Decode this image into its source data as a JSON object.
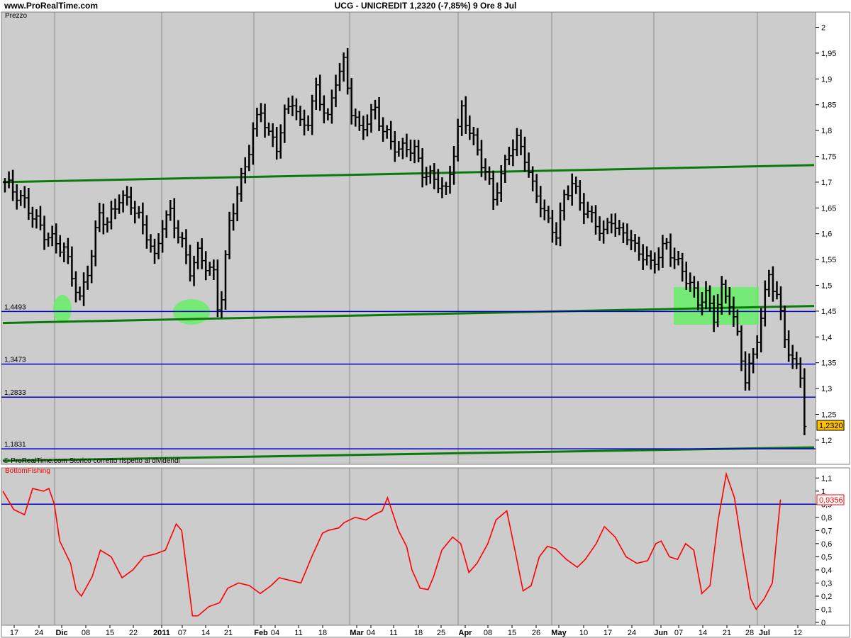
{
  "header": {
    "site": "www.ProRealTime.com",
    "title": "UCG - UNICREDIT    1,2320 (-7,85%)   9 Ore  8 Jul"
  },
  "price_panel": {
    "label": "Prezzo",
    "footer": "© ProRealTime.com   Storico corretto rispetto ai dividendi",
    "last_value_label": "1,2320",
    "support_labels": [
      "1,4493",
      "1,3473",
      "1,2833",
      "1,1831"
    ],
    "y_ticks": [
      "2",
      "1,95",
      "1,9",
      "1,85",
      "1,8",
      "1,75",
      "1,7",
      "1,65",
      "1,6",
      "1,55",
      "1,5",
      "1,45",
      "1,4",
      "1,35",
      "1,3",
      "1,25",
      "1,2"
    ]
  },
  "indicator_panel": {
    "label": "BottomFishing",
    "last_value_label": "0,9356",
    "y_ticks": [
      "1,1",
      "1",
      "0,9",
      "0,8",
      "0,7",
      "0,6",
      "0,5",
      "0,4",
      "0,3",
      "0,2",
      "0,1",
      "0"
    ]
  },
  "x_ticks": [
    "17",
    "24",
    "Dic",
    "08",
    "15",
    "22",
    "2011",
    "07",
    "14",
    "21",
    "Feb",
    "04",
    "11",
    "18",
    "Mar",
    "04",
    "11",
    "18",
    "25",
    "Apr",
    "08",
    "15",
    "26",
    "May",
    "10",
    "17",
    "24",
    "Jun",
    "07",
    "14",
    "21",
    "28",
    "Jul",
    "12"
  ],
  "colors": {
    "background": "#cccccc",
    "price_bars": "#000000",
    "support_lines": "#0000cc",
    "trend_lines": "#0a7a0a",
    "highlight": "#66ee66",
    "indicator_line": "#ff0000",
    "value_box": "#ffc000"
  },
  "chart_data": [
    {
      "type": "bar",
      "subtype": "ohlc",
      "title": "UCG - UNICREDIT",
      "ylim": [
        1.16,
        2.02
      ],
      "x_categories": [
        "17",
        "24",
        "Dic",
        "08",
        "15",
        "22",
        "2011",
        "07",
        "14",
        "21",
        "Feb",
        "04",
        "11",
        "18",
        "Mar",
        "04",
        "11",
        "18",
        "25",
        "Apr",
        "08",
        "15",
        "26",
        "May",
        "10",
        "17",
        "24",
        "Jun",
        "07",
        "14",
        "21",
        "28",
        "Jul",
        "12"
      ],
      "close_path": [
        [
          0,
          1.7
        ],
        [
          5,
          1.66
        ],
        [
          10,
          1.6
        ],
        [
          15,
          1.57
        ],
        [
          19,
          1.47
        ],
        [
          22,
          1.56
        ],
        [
          24,
          1.64
        ],
        [
          26,
          1.62
        ],
        [
          29,
          1.67
        ],
        [
          32,
          1.66
        ],
        [
          36,
          1.6
        ],
        [
          38,
          1.55
        ],
        [
          40,
          1.62
        ],
        [
          42,
          1.64
        ],
        [
          45,
          1.58
        ],
        [
          47,
          1.53
        ],
        [
          49,
          1.56
        ],
        [
          51,
          1.54
        ],
        [
          53,
          1.52
        ],
        [
          54,
          1.46
        ],
        [
          55,
          1.48
        ],
        [
          57,
          1.62
        ],
        [
          59,
          1.68
        ],
        [
          61,
          1.73
        ],
        [
          63,
          1.8
        ],
        [
          65,
          1.84
        ],
        [
          67,
          1.79
        ],
        [
          69,
          1.77
        ],
        [
          71,
          1.83
        ],
        [
          73,
          1.86
        ],
        [
          75,
          1.81
        ],
        [
          77,
          1.82
        ],
        [
          79,
          1.88
        ],
        [
          80,
          1.86
        ],
        [
          82,
          1.82
        ],
        [
          84,
          1.9
        ],
        [
          86,
          1.93
        ],
        [
          88,
          1.84
        ],
        [
          90,
          1.8
        ],
        [
          92,
          1.82
        ],
        [
          94,
          1.84
        ],
        [
          96,
          1.8
        ],
        [
          98,
          1.78
        ],
        [
          100,
          1.76
        ],
        [
          102,
          1.77
        ],
        [
          104,
          1.76
        ],
        [
          106,
          1.72
        ],
        [
          108,
          1.71
        ],
        [
          110,
          1.7
        ],
        [
          112,
          1.68
        ],
        [
          114,
          1.76
        ],
        [
          116,
          1.84
        ],
        [
          118,
          1.8
        ],
        [
          120,
          1.76
        ],
        [
          122,
          1.72
        ],
        [
          124,
          1.67
        ],
        [
          126,
          1.71
        ],
        [
          128,
          1.76
        ],
        [
          130,
          1.78
        ],
        [
          132,
          1.75
        ],
        [
          134,
          1.69
        ],
        [
          136,
          1.66
        ],
        [
          138,
          1.62
        ],
        [
          140,
          1.6
        ],
        [
          142,
          1.67
        ],
        [
          144,
          1.7
        ],
        [
          146,
          1.66
        ],
        [
          148,
          1.64
        ],
        [
          150,
          1.62
        ],
        [
          152,
          1.6
        ],
        [
          154,
          1.63
        ],
        [
          156,
          1.6
        ],
        [
          158,
          1.6
        ],
        [
          160,
          1.57
        ],
        [
          162,
          1.56
        ],
        [
          164,
          1.54
        ],
        [
          166,
          1.56
        ],
        [
          168,
          1.58
        ],
        [
          170,
          1.55
        ],
        [
          172,
          1.53
        ],
        [
          174,
          1.5
        ],
        [
          176,
          1.47
        ],
        [
          178,
          1.48
        ],
        [
          180,
          1.44
        ],
        [
          182,
          1.49
        ],
        [
          184,
          1.47
        ],
        [
          186,
          1.4
        ],
        [
          188,
          1.32
        ],
        [
          190,
          1.36
        ],
        [
          192,
          1.44
        ],
        [
          194,
          1.52
        ],
        [
          196,
          1.48
        ],
        [
          198,
          1.4
        ],
        [
          200,
          1.35
        ],
        [
          202,
          1.33
        ],
        [
          203,
          1.232
        ]
      ],
      "support_lines": [
        1.4493,
        1.3473,
        1.2833,
        1.1831
      ],
      "trend_lines": [
        {
          "from": [
            0,
            1.7
          ],
          "to": [
            206,
            1.733
          ]
        },
        {
          "from": [
            0,
            1.427
          ],
          "to": [
            206,
            1.46
          ]
        },
        {
          "from": [
            0,
            1.16
          ],
          "to": [
            206,
            1.186
          ]
        }
      ],
      "last_value": 1.232,
      "change_pct": -7.85
    },
    {
      "type": "line",
      "title": "BottomFishing",
      "ylim": [
        0,
        1.15
      ],
      "reference_line": 0.9,
      "series": [
        {
          "name": "BottomFishing",
          "values": [
            [
              0,
              1.0
            ],
            [
              4,
              0.86
            ],
            [
              8,
              0.82
            ],
            [
              11,
              1.02
            ],
            [
              15,
              1.0
            ],
            [
              17,
              1.02
            ],
            [
              19,
              0.9
            ],
            [
              21,
              0.62
            ],
            [
              25,
              0.45
            ],
            [
              27,
              0.25
            ],
            [
              29,
              0.2
            ],
            [
              33,
              0.35
            ],
            [
              36,
              0.55
            ],
            [
              40,
              0.5
            ],
            [
              44,
              0.34
            ],
            [
              48,
              0.4
            ],
            [
              52,
              0.5
            ],
            [
              56,
              0.52
            ],
            [
              60,
              0.55
            ],
            [
              64,
              0.75
            ],
            [
              66,
              0.7
            ],
            [
              70,
              0.05
            ],
            [
              72,
              0.05
            ],
            [
              76,
              0.12
            ],
            [
              80,
              0.15
            ],
            [
              83,
              0.26
            ],
            [
              87,
              0.3
            ],
            [
              91,
              0.28
            ],
            [
              95,
              0.22
            ],
            [
              99,
              0.28
            ],
            [
              102,
              0.34
            ],
            [
              106,
              0.32
            ],
            [
              110,
              0.3
            ],
            [
              114,
              0.5
            ],
            [
              118,
              0.68
            ],
            [
              120,
              0.7
            ],
            [
              124,
              0.72
            ],
            [
              126,
              0.76
            ],
            [
              130,
              0.8
            ],
            [
              134,
              0.78
            ],
            [
              137,
              0.82
            ],
            [
              140,
              0.85
            ],
            [
              142,
              0.95
            ],
            [
              146,
              0.7
            ],
            [
              149,
              0.58
            ],
            [
              151,
              0.4
            ],
            [
              154,
              0.26
            ],
            [
              157,
              0.25
            ],
            [
              159,
              0.35
            ],
            [
              162,
              0.55
            ],
            [
              166,
              0.65
            ],
            [
              169,
              0.6
            ],
            [
              172,
              0.38
            ],
            [
              175,
              0.45
            ],
            [
              179,
              0.6
            ],
            [
              182,
              0.78
            ],
            [
              186,
              0.85
            ],
            [
              189,
              0.55
            ],
            [
              192,
              0.24
            ],
            [
              195,
              0.28
            ],
            [
              198,
              0.5
            ],
            [
              201,
              0.58
            ],
            [
              204,
              0.56
            ],
            [
              208,
              0.48
            ],
            [
              212,
              0.42
            ],
            [
              215,
              0.48
            ],
            [
              219,
              0.6
            ],
            [
              222,
              0.73
            ],
            [
              226,
              0.65
            ],
            [
              230,
              0.5
            ],
            [
              234,
              0.45
            ],
            [
              238,
              0.47
            ],
            [
              241,
              0.6
            ],
            [
              243,
              0.62
            ],
            [
              246,
              0.5
            ],
            [
              249,
              0.48
            ],
            [
              252,
              0.6
            ],
            [
              255,
              0.55
            ],
            [
              258,
              0.22
            ],
            [
              261,
              0.28
            ],
            [
              264,
              0.78
            ],
            [
              267,
              1.13
            ],
            [
              270,
              0.95
            ],
            [
              273,
              0.55
            ],
            [
              276,
              0.18
            ],
            [
              278,
              0.1
            ],
            [
              281,
              0.18
            ],
            [
              284,
              0.3
            ],
            [
              287,
              0.9356
            ]
          ]
        }
      ],
      "last_value": 0.9356
    }
  ]
}
